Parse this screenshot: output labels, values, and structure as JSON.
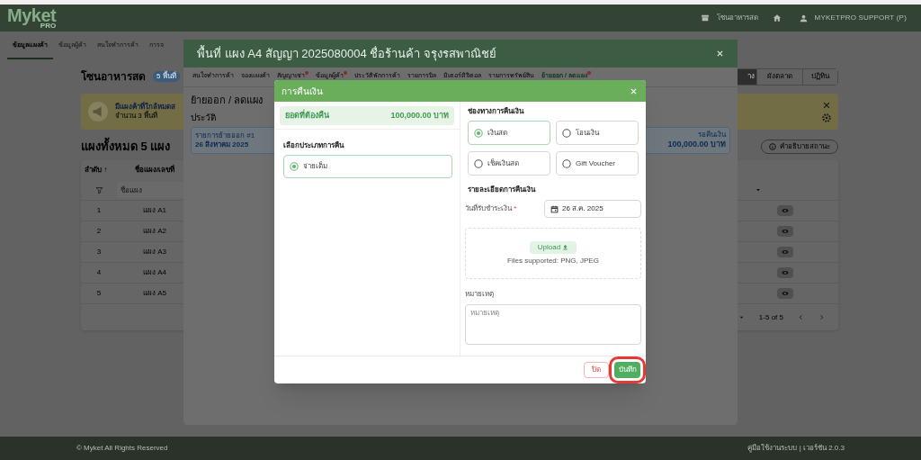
{
  "header": {
    "logo": "Myket",
    "logo_badge": "PRO",
    "zone": "โซนอาหารสด",
    "user": "MYKETPRO SUPPORT (P)"
  },
  "nav_tabs": [
    {
      "label": "ข้อมูลแผงค้า",
      "selected": true
    },
    {
      "label": "ข้อมูลผู้ค้า",
      "selected": false
    },
    {
      "label": "สนใจทำการค้า",
      "selected": false
    },
    {
      "label": "การจ",
      "selected": false
    }
  ],
  "page": {
    "title": "โซนอาหารสด",
    "badge": "5 พื้นที่",
    "view_buttons": [
      {
        "label": "าง",
        "selected": true
      },
      {
        "label": "ผังตลาด",
        "selected": false
      },
      {
        "label": "ปฏิทิน",
        "selected": false
      }
    ],
    "alert": {
      "title": "มีแผงค้าที่ใกล้หมดส",
      "subtitle": "จำนวน 3 พื้นที่"
    },
    "section_title": "แผงทั้งหมด 5 แผง",
    "legend_button": "คำอธิบายสถานะ"
  },
  "table": {
    "columns": [
      "ลำดับ ↑",
      "ชื่อแผง/เลขที่"
    ],
    "filter_placeholder": "ชื่อแผง",
    "rows": [
      {
        "index": "1",
        "name": "แผง A1"
      },
      {
        "index": "2",
        "name": "แผง A2"
      },
      {
        "index": "3",
        "name": "แผง A3"
      },
      {
        "index": "4",
        "name": "แผง A4"
      },
      {
        "index": "5",
        "name": "แผง A5"
      }
    ],
    "pagination": "1-5 of 5"
  },
  "footer": {
    "copyright": "© Myket All Rights Reserved",
    "links": "คู่มือใช้งานระบบ | เวอร์ชัน 2.0.3"
  },
  "stall_dialog": {
    "title": "พื้นที่ แผง A4 สัญญา 2025080004 ชื่อร้านค้า จรุงรสพาณิชย์",
    "tabs": [
      {
        "label": "สนใจทำการค้า",
        "dot": false,
        "selected": false
      },
      {
        "label": "จองแผงค้า",
        "dot": false,
        "selected": false
      },
      {
        "label": "สัญญาเช่า",
        "dot": true,
        "selected": false
      },
      {
        "label": "ข้อมูลผู้ค้า",
        "dot": true,
        "selected": false
      },
      {
        "label": "ประวัติพักการค้า",
        "dot": false,
        "selected": false
      },
      {
        "label": "รายการบิล",
        "dot": false,
        "selected": false
      },
      {
        "label": "มิเตอร์ดิจิตอล",
        "dot": false,
        "selected": false
      },
      {
        "label": "รายการทรัพย์สิน",
        "dot": false,
        "selected": false
      },
      {
        "label": "ย้ายออก / ลดแผง",
        "dot": true,
        "selected": true
      }
    ],
    "section_title": "ย้ายออก / ลดแผง",
    "history_label": "ประวัติ",
    "history_card": {
      "title": "รายการย้ายออก #1",
      "date": "26 สิงหาคม 2025",
      "status": "รอคืนเงิน",
      "amount": "100,000.00 บาท"
    }
  },
  "refund_dialog": {
    "title": "การคืนเงิน",
    "amount_label": "ยอดที่ต้องคืน",
    "amount": "100,000.00 บาท",
    "type_label": "เลือกประเภทการคืน",
    "types": [
      {
        "label": "จ่ายเต็ม",
        "selected": true
      }
    ],
    "channel_label": "ช่องทางการคืนเงิน",
    "channels": [
      {
        "label": "เงินสด",
        "selected": true
      },
      {
        "label": "โอนเงิน",
        "selected": false
      },
      {
        "label": "เช็คเงินสด",
        "selected": false
      },
      {
        "label": "Gift Voucher",
        "selected": false
      }
    ],
    "details_label": "รายละเอียดการคืนเงิน",
    "date_label": "วันที่รับชำระเงิน",
    "required_mark": "*",
    "date_value": "26 ส.ค. 2025",
    "upload_button": "Upload",
    "upload_hint": "Files supported: PNG, JPEG",
    "note_label": "หมายเหตุ",
    "note_placeholder": "หมายเหตุ",
    "buttons": [
      {
        "label": "ปิด",
        "kind": "secondary",
        "highlighted": false
      },
      {
        "label": "บันทึก",
        "kind": "primary",
        "highlighted": true
      }
    ]
  }
}
